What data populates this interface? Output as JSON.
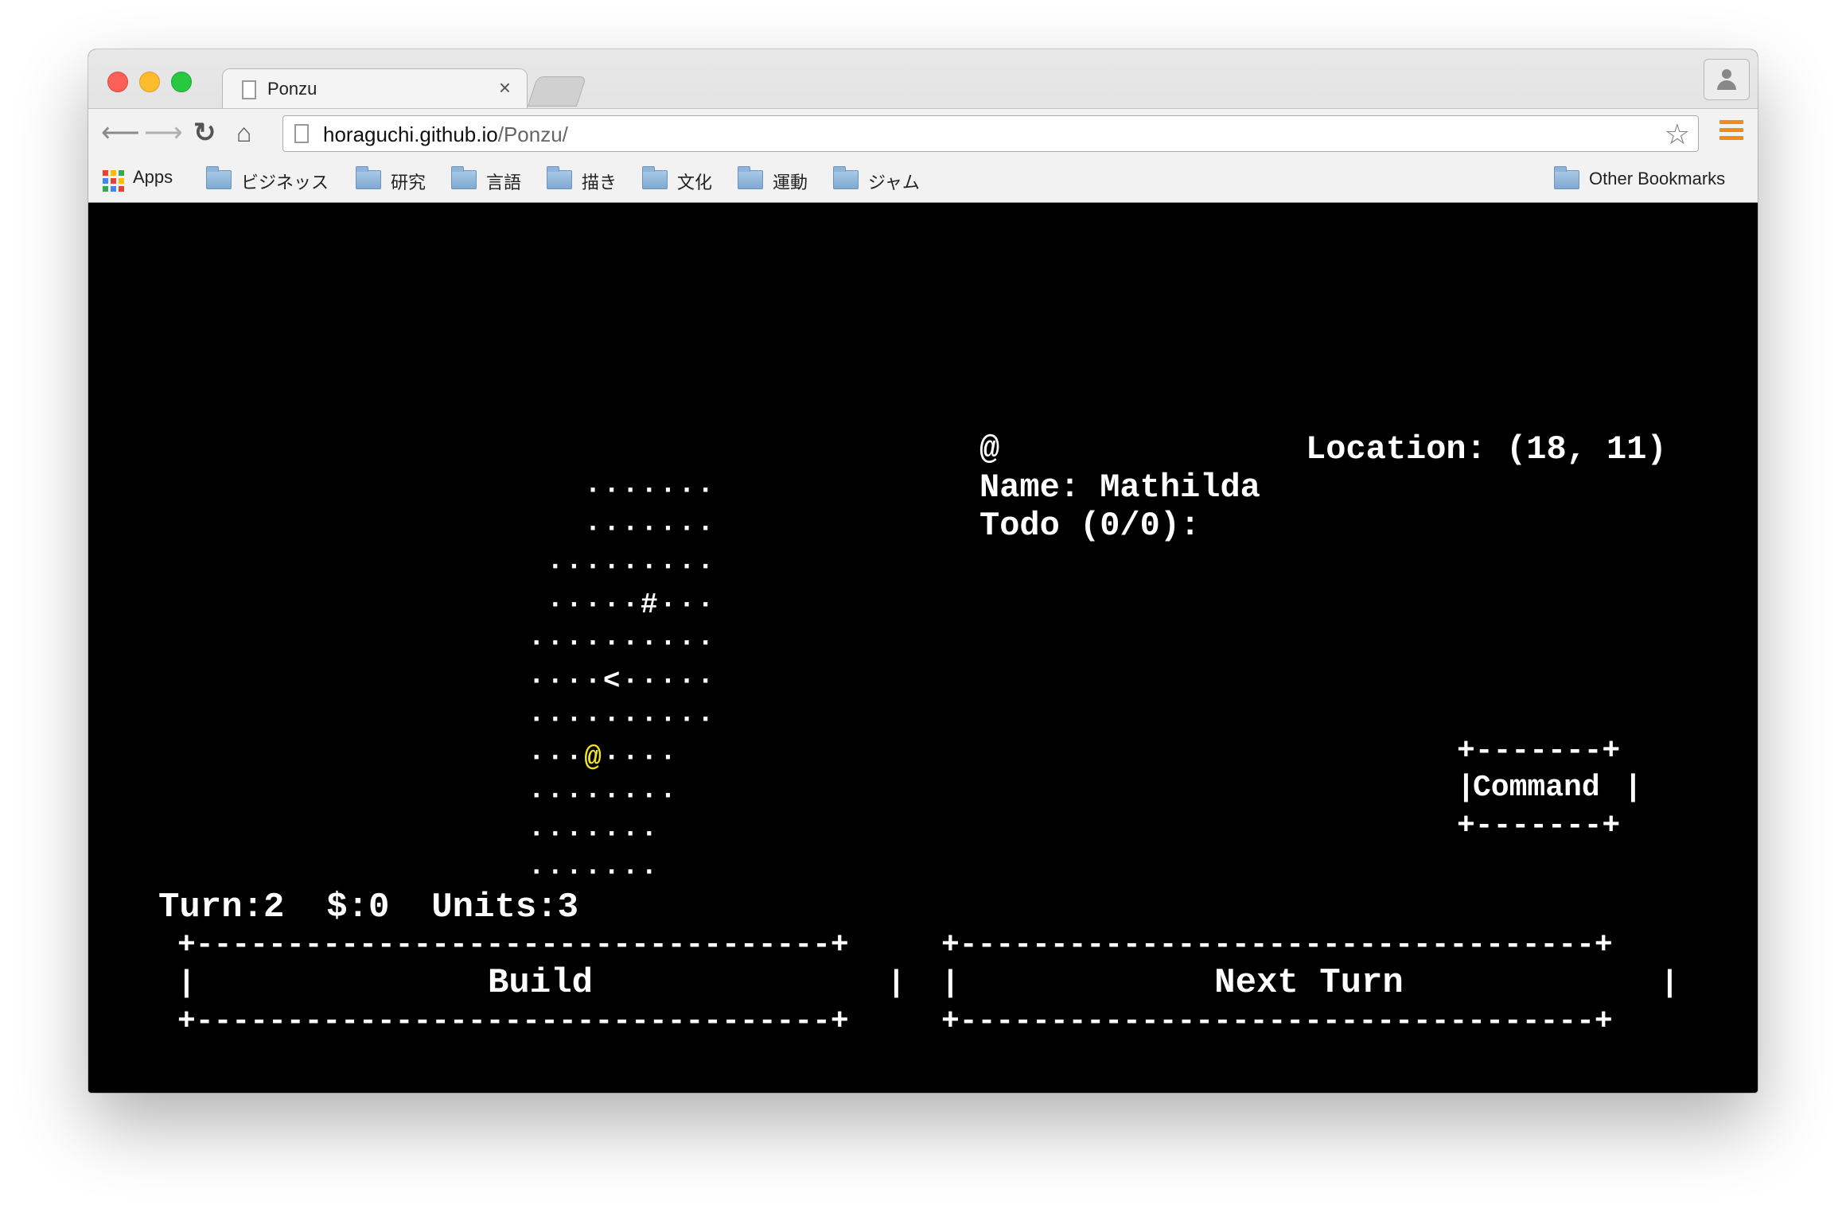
{
  "browser": {
    "tab_title": "Ponzu",
    "tab_close": "×",
    "url_host": "horaguchi.github.io",
    "url_path": "/Ponzu/",
    "bookmarks": {
      "apps": "Apps",
      "folders": [
        "ビジネッス",
        "研究",
        "言語",
        "描き",
        "文化",
        "運動",
        "ジャム"
      ],
      "other": "Other Bookmarks"
    }
  },
  "game": {
    "map_rows": [
      "       ·······",
      "       ·······",
      "     ·········",
      "     ·····#···",
      "    ··········",
      "    ····<·····",
      "    ··········",
      "    ···",
      "    ········",
      "    ·······",
      "    ·······"
    ],
    "player_row_rest": "····",
    "player_symbol": "@",
    "unit_symbol": "@",
    "name_line": "Name: Mathilda",
    "todo_line": "Todo (0/0):",
    "location_line": "Location: (18, 11)",
    "status_line": "Turn:2  $:0  Units:3",
    "command_label": "Command",
    "build_label": "Build",
    "next_turn_label": "Next Turn"
  },
  "colors": {
    "background": "#000000",
    "text": "#ffffff",
    "player": "#f1e61a",
    "menu_accent": "#f08a1a"
  }
}
